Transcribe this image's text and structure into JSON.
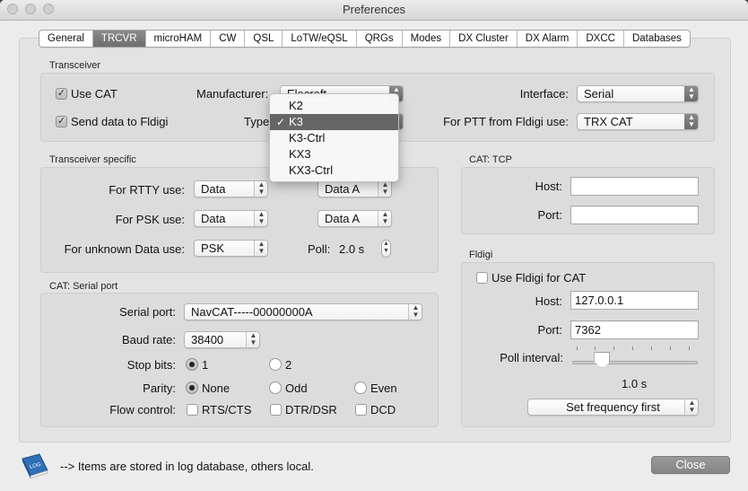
{
  "window": {
    "title": "Preferences"
  },
  "tabs": [
    "General",
    "TRCVR",
    "microHAM",
    "CW",
    "QSL",
    "LoTW/eQSL",
    "QRGs",
    "Modes",
    "DX Cluster",
    "DX Alarm",
    "DXCC",
    "Databases"
  ],
  "active_tab": "TRCVR",
  "transceiver": {
    "title": "Transceiver",
    "use_cat_label": "Use CAT",
    "use_cat_checked": true,
    "send_fldigi_label": "Send data to Fldigi",
    "send_fldigi_checked": true,
    "manufacturer_label": "Manufacturer:",
    "manufacturer_value": "Elecraft",
    "type_label": "Type",
    "type_options": [
      "K2",
      "K3",
      "K3-Ctrl",
      "KX3",
      "KX3-Ctrl"
    ],
    "type_selected": "K3",
    "interface_label": "Interface:",
    "interface_value": "Serial",
    "ptt_label": "For PTT from Fldigi use:",
    "ptt_value": "TRX CAT"
  },
  "transceiver_specific": {
    "title": "Transceiver specific",
    "rtty_label": "For RTTY use:",
    "rtty_value": "Data",
    "rtty_value2": "Data A",
    "psk_label": "For PSK use:",
    "psk_value": "Data",
    "psk_value2": "Data A",
    "unknown_label": "For unknown Data use:",
    "unknown_value": "PSK",
    "poll_label": "Poll:",
    "poll_value": "2.0 s"
  },
  "cat_tcp": {
    "title": "CAT: TCP",
    "host_label": "Host:",
    "host_value": "",
    "port_label": "Port:",
    "port_value": ""
  },
  "cat_serial": {
    "title": "CAT: Serial port",
    "serial_port_label": "Serial port:",
    "serial_port_value": "NavCAT-----00000000A",
    "baud_label": "Baud rate:",
    "baud_value": "38400",
    "stop_bits_label": "Stop bits:",
    "stop_bits_1": "1",
    "stop_bits_2": "2",
    "parity_label": "Parity:",
    "parity_none": "None",
    "parity_odd": "Odd",
    "parity_even": "Even",
    "flow_label": "Flow control:",
    "flow_rts": "RTS/CTS",
    "flow_dtr": "DTR/DSR",
    "flow_dcd": "DCD"
  },
  "fldigi": {
    "title": "Fldigi",
    "use_label": "Use Fldigi for CAT",
    "use_checked": false,
    "host_label": "Host:",
    "host_value": "127.0.0.1",
    "port_label": "Port:",
    "port_value": "7362",
    "poll_label": "Poll interval:",
    "poll_value": "1.0 s",
    "poll_fraction": 0.2,
    "set_freq_value": "Set frequency first"
  },
  "footer": {
    "icon": "log-book-icon",
    "icon_text": "LOG",
    "note": "--> Items are stored in log database, others local.",
    "close_label": "Close"
  }
}
